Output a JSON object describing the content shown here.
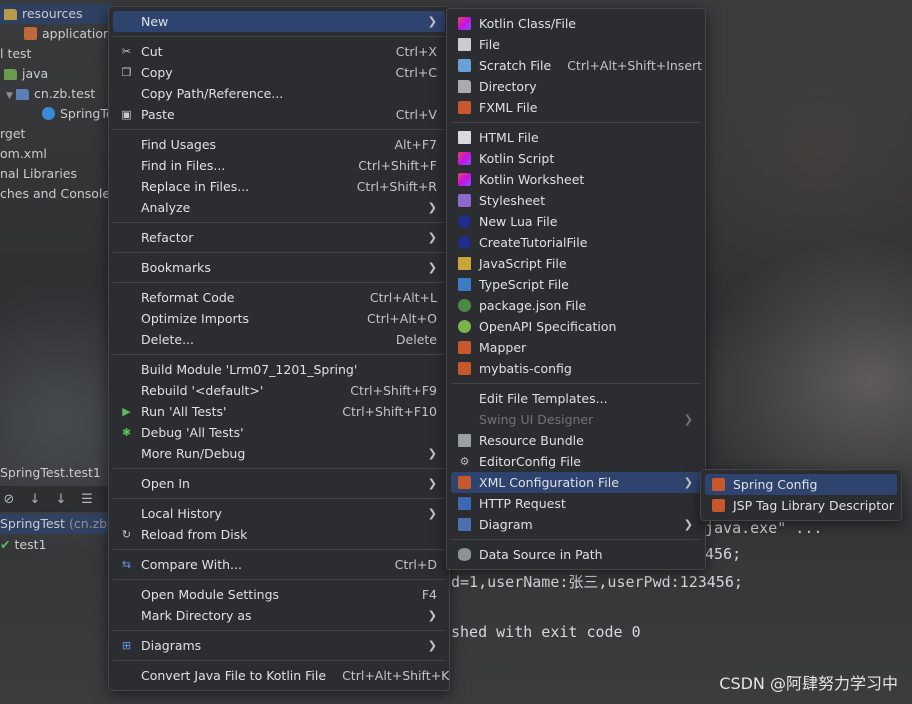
{
  "project_tree": {
    "rows": [
      {
        "label": "resources",
        "icon": "folder-icon"
      },
      {
        "label": "application.",
        "icon": "xml-file-icon"
      },
      {
        "label": "l test",
        "icon": ""
      },
      {
        "label": "java",
        "icon": "folder-icon"
      },
      {
        "label": "cn.zb.test",
        "icon": "package-icon"
      },
      {
        "label": "SpringTe",
        "icon": "class-icon"
      },
      {
        "label": "rget",
        "icon": ""
      },
      {
        "label": "om.xml",
        "icon": ""
      },
      {
        "label": "nal Libraries",
        "icon": ""
      },
      {
        "label": "ches and Consoles",
        "icon": ""
      }
    ],
    "run_tab_label": "SpringTest.test1",
    "run_tree": [
      {
        "label": "SpringTest",
        "suffix": "(cn.zb.te"
      },
      {
        "label": "test1"
      }
    ]
  },
  "console": {
    "line1": "java.exe\" ...",
    "line2": "456;",
    "line3": "d=1,userName:张三,userPwd:123456;",
    "line4": "shed with exit code 0"
  },
  "watermark": "CSDN @阿肆努力学习中",
  "context_menu": {
    "new": "New",
    "cut": "Cut",
    "cut_sc": "Ctrl+X",
    "copy": "Copy",
    "copy_sc": "Ctrl+C",
    "copy_path": "Copy Path/Reference...",
    "paste": "Paste",
    "paste_sc": "Ctrl+V",
    "find_usages": "Find Usages",
    "find_usages_sc": "Alt+F7",
    "find_in_files": "Find in Files...",
    "find_in_files_sc": "Ctrl+Shift+F",
    "replace_in_files": "Replace in Files...",
    "replace_in_files_sc": "Ctrl+Shift+R",
    "analyze": "Analyze",
    "refactor": "Refactor",
    "bookmarks": "Bookmarks",
    "reformat": "Reformat Code",
    "reformat_sc": "Ctrl+Alt+L",
    "optimize": "Optimize Imports",
    "optimize_sc": "Ctrl+Alt+O",
    "delete": "Delete...",
    "delete_sc": "Delete",
    "build_module": "Build Module 'Lrm07_1201_Spring'",
    "rebuild": "Rebuild '<default>'",
    "rebuild_sc": "Ctrl+Shift+F9",
    "run_all": "Run 'All Tests'",
    "run_all_sc": "Ctrl+Shift+F10",
    "debug_all": "Debug 'All Tests'",
    "more_run": "More Run/Debug",
    "open_in": "Open In",
    "local_history": "Local History",
    "reload": "Reload from Disk",
    "compare": "Compare With...",
    "compare_sc": "Ctrl+D",
    "module_settings": "Open Module Settings",
    "module_settings_sc": "F4",
    "mark_dir": "Mark Directory as",
    "diagrams": "Diagrams",
    "convert": "Convert Java File to Kotlin File",
    "convert_sc": "Ctrl+Alt+Shift+K"
  },
  "new_menu": {
    "kotlin_class": "Kotlin Class/File",
    "file": "File",
    "scratch": "Scratch File",
    "scratch_sc": "Ctrl+Alt+Shift+Insert",
    "directory": "Directory",
    "fxml": "FXML File",
    "html": "HTML File",
    "kotlin_script": "Kotlin Script",
    "kotlin_worksheet": "Kotlin Worksheet",
    "stylesheet": "Stylesheet",
    "new_lua": "New Lua File",
    "create_tutorial": "CreateTutorialFile",
    "javascript": "JavaScript File",
    "typescript": "TypeScript File",
    "package_json": "package.json File",
    "openapi": "OpenAPI Specification",
    "mapper": "Mapper",
    "mybatis": "mybatis-config",
    "edit_templates": "Edit File Templates...",
    "swing": "Swing UI Designer",
    "resource_bundle": "Resource Bundle",
    "editorconfig": "EditorConfig File",
    "xml_config": "XML Configuration File",
    "http_request": "HTTP Request",
    "diagram": "Diagram",
    "data_source": "Data Source in Path"
  },
  "xml_menu": {
    "spring_config": "Spring Config",
    "jsp_tag": "JSP Tag Library Descriptor"
  },
  "colors": {
    "menu_bg": "#2b2d30",
    "highlight": "#2e436e",
    "text": "#dfe1e5",
    "disabled": "#6f7378"
  }
}
